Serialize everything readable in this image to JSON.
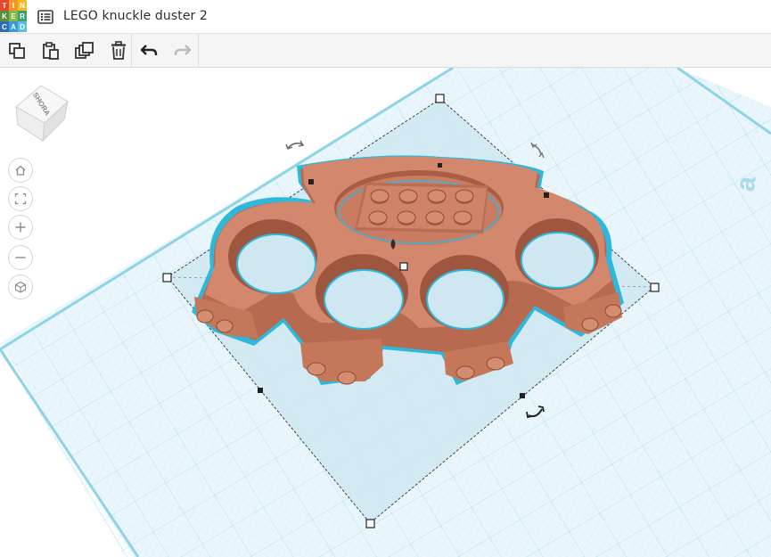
{
  "header": {
    "logo_letters": [
      "T",
      "I",
      "N",
      "K",
      "E",
      "R",
      "C",
      "A",
      "D"
    ],
    "logo_colors": [
      "#e8462c",
      "#f29829",
      "#f7b921",
      "#5a8e3a",
      "#82b84a",
      "#3e9f6f",
      "#2b6eb4",
      "#3b9ad6",
      "#5cbde9"
    ],
    "design_title": "LEGO knuckle duster 2",
    "list_icon": "list-icon"
  },
  "toolbar": {
    "buttons": [
      {
        "icon": "copy-icon"
      },
      {
        "icon": "paste-icon"
      },
      {
        "icon": "duplicate-icon"
      },
      {
        "icon": "trash-icon"
      },
      {
        "icon": "undo-icon"
      },
      {
        "icon": "redo-icon"
      }
    ]
  },
  "viewcube": {
    "face_label": "SHORA"
  },
  "view_controls": [
    {
      "icon": "home-icon"
    },
    {
      "icon": "fit-view-icon"
    },
    {
      "icon": "zoom-in-icon"
    },
    {
      "icon": "zoom-out-icon"
    },
    {
      "icon": "perspective-cube-icon"
    }
  ],
  "workplane": {
    "grid_color": "#c8e8f3",
    "plane_color": "#e9f6fb",
    "edge_color": "#7ccde3",
    "edge_label": "a"
  },
  "model": {
    "name": "knuckle-duster",
    "body_color": "#c97c62",
    "outline_color": "#29b3d8",
    "selection_fill": "#cfe7f1"
  }
}
